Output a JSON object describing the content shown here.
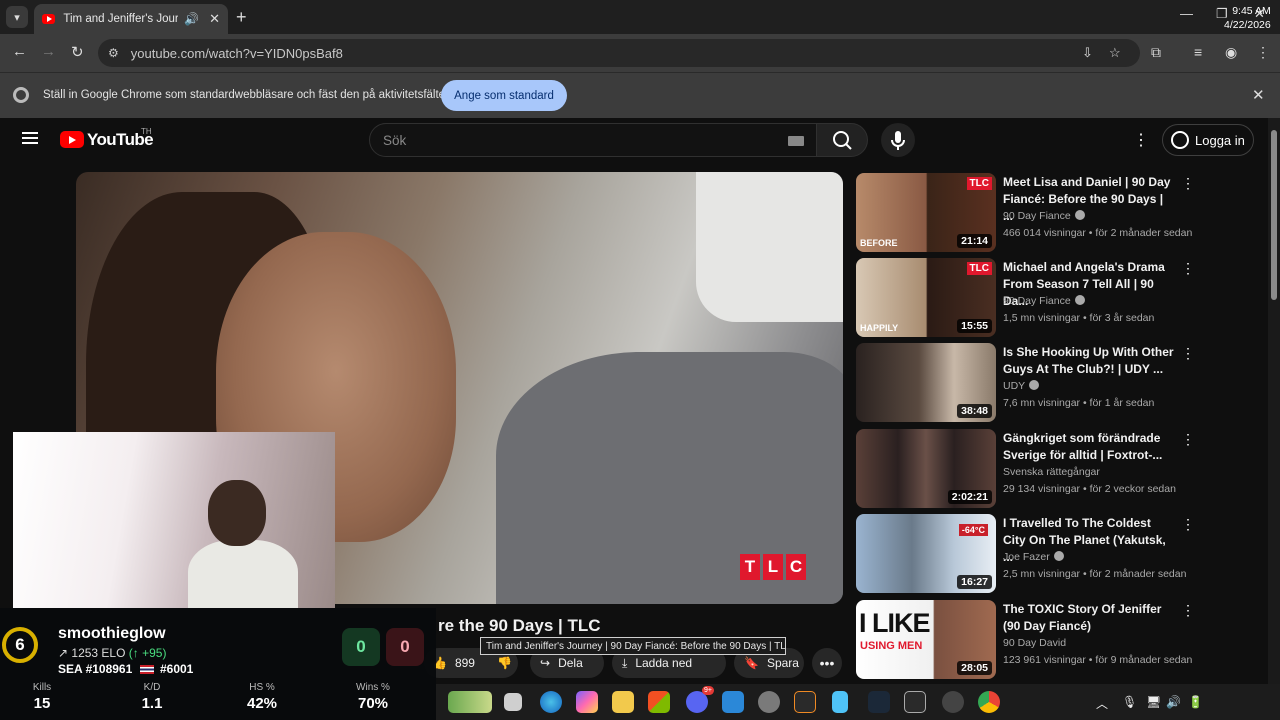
{
  "browser": {
    "tab_title": "Tim and Jeniffer's Journey |",
    "url": "youtube.com/watch?v=YIDN0psBaf8",
    "infobar_message": "Ställ in Google Chrome som standardwebbläsare och fäst den på aktivitetsfältet",
    "infobar_button": "Ange som standard"
  },
  "youtube": {
    "logo_text": "YouTube",
    "logo_country": "TH",
    "search_placeholder": "Sök",
    "signin_label": "Logga in"
  },
  "video": {
    "title_visible": "re the 90 Days | TLC",
    "tooltip": "Tim and Jeniffer's Journey | 90 Day Fiancé: Before the 90 Days | TLC",
    "like_count": "899",
    "share_label": "Dela",
    "download_label": "Ladda ned",
    "save_label": "Spara",
    "watermark": [
      "T",
      "L",
      "C"
    ]
  },
  "recommendations": [
    {
      "title": "Meet Lisa and Daniel | 90 Day Fiancé: Before the 90 Days | ...",
      "channel": "90 Day Fiance",
      "verified": true,
      "meta": "466 014 visningar • för 2 månader sedan",
      "duration": "21:14",
      "thumb_color": "#7a4a3a"
    },
    {
      "title": "Michael and Angela's Drama From Season 7 Tell All | 90 Da...",
      "channel": "90 Day Fiance",
      "verified": true,
      "meta": "1,5 mn visningar • för 3 år sedan",
      "duration": "15:55",
      "thumb_color": "#5a3a2a"
    },
    {
      "title": "Is She Hooking Up With Other Guys At The Club?! | UDY ...",
      "channel": "UDY",
      "verified": true,
      "meta": "7,6 mn visningar • för 1 år sedan",
      "duration": "38:48",
      "thumb_color": "#6a5a4a"
    },
    {
      "title": "Gängkriget som förändrade Sverige för alltid | Foxtrot-...",
      "channel": "Svenska rättegångar",
      "verified": false,
      "meta": "29 134 visningar • för 2 veckor sedan",
      "duration": "2:02:21",
      "thumb_color": "#4a3a34"
    },
    {
      "title": "I Travelled To The Coldest City On The Planet (Yakutsk, ...",
      "channel": "Joe Fazer",
      "verified": true,
      "meta": "2,5 mn visningar • för 2 månader sedan",
      "duration": "16:27",
      "thumb_color": "#8aa8c8"
    },
    {
      "title": "The TOXIC Story Of Jeniffer (90 Day Fiancé)",
      "channel": "90 Day David",
      "verified": false,
      "meta": "123 961 visningar • för 9 månader sedan",
      "duration": "28:05",
      "thumb_color": "#f2f2f2"
    }
  ],
  "thumb_texts": {
    "r1_badge": "TLC",
    "r1_caption": "BEFORE",
    "r2_badge": "TLC",
    "r2_caption": "HAPPILY",
    "r5_sign": "-64°C",
    "r6_line1": "I LIKE",
    "r6_line2": "USING MEN"
  },
  "overlay": {
    "rank": "6",
    "username": "smoothieglow",
    "elo": "1253 ELO",
    "elo_change": "+95",
    "region_rank": "SEA #108961",
    "country_rank": "#6001",
    "score_left": "0",
    "score_right": "0",
    "stats": [
      {
        "label": "Kills",
        "value": "15"
      },
      {
        "label": "K/D",
        "value": "1.1"
      },
      {
        "label": "HS %",
        "value": "42%"
      },
      {
        "label": "Wins %",
        "value": "70%"
      }
    ]
  },
  "taskbar": {
    "time": "9:45 AM",
    "date": "4/22/2026",
    "discord_badge": "9+"
  },
  "colors": {
    "youtube_red": "#ff0000",
    "tlc_red": "#e0182d",
    "infobar_button": "#a8c7fa",
    "rank_ring": "#d8b000",
    "elo_up": "#4ade80"
  }
}
